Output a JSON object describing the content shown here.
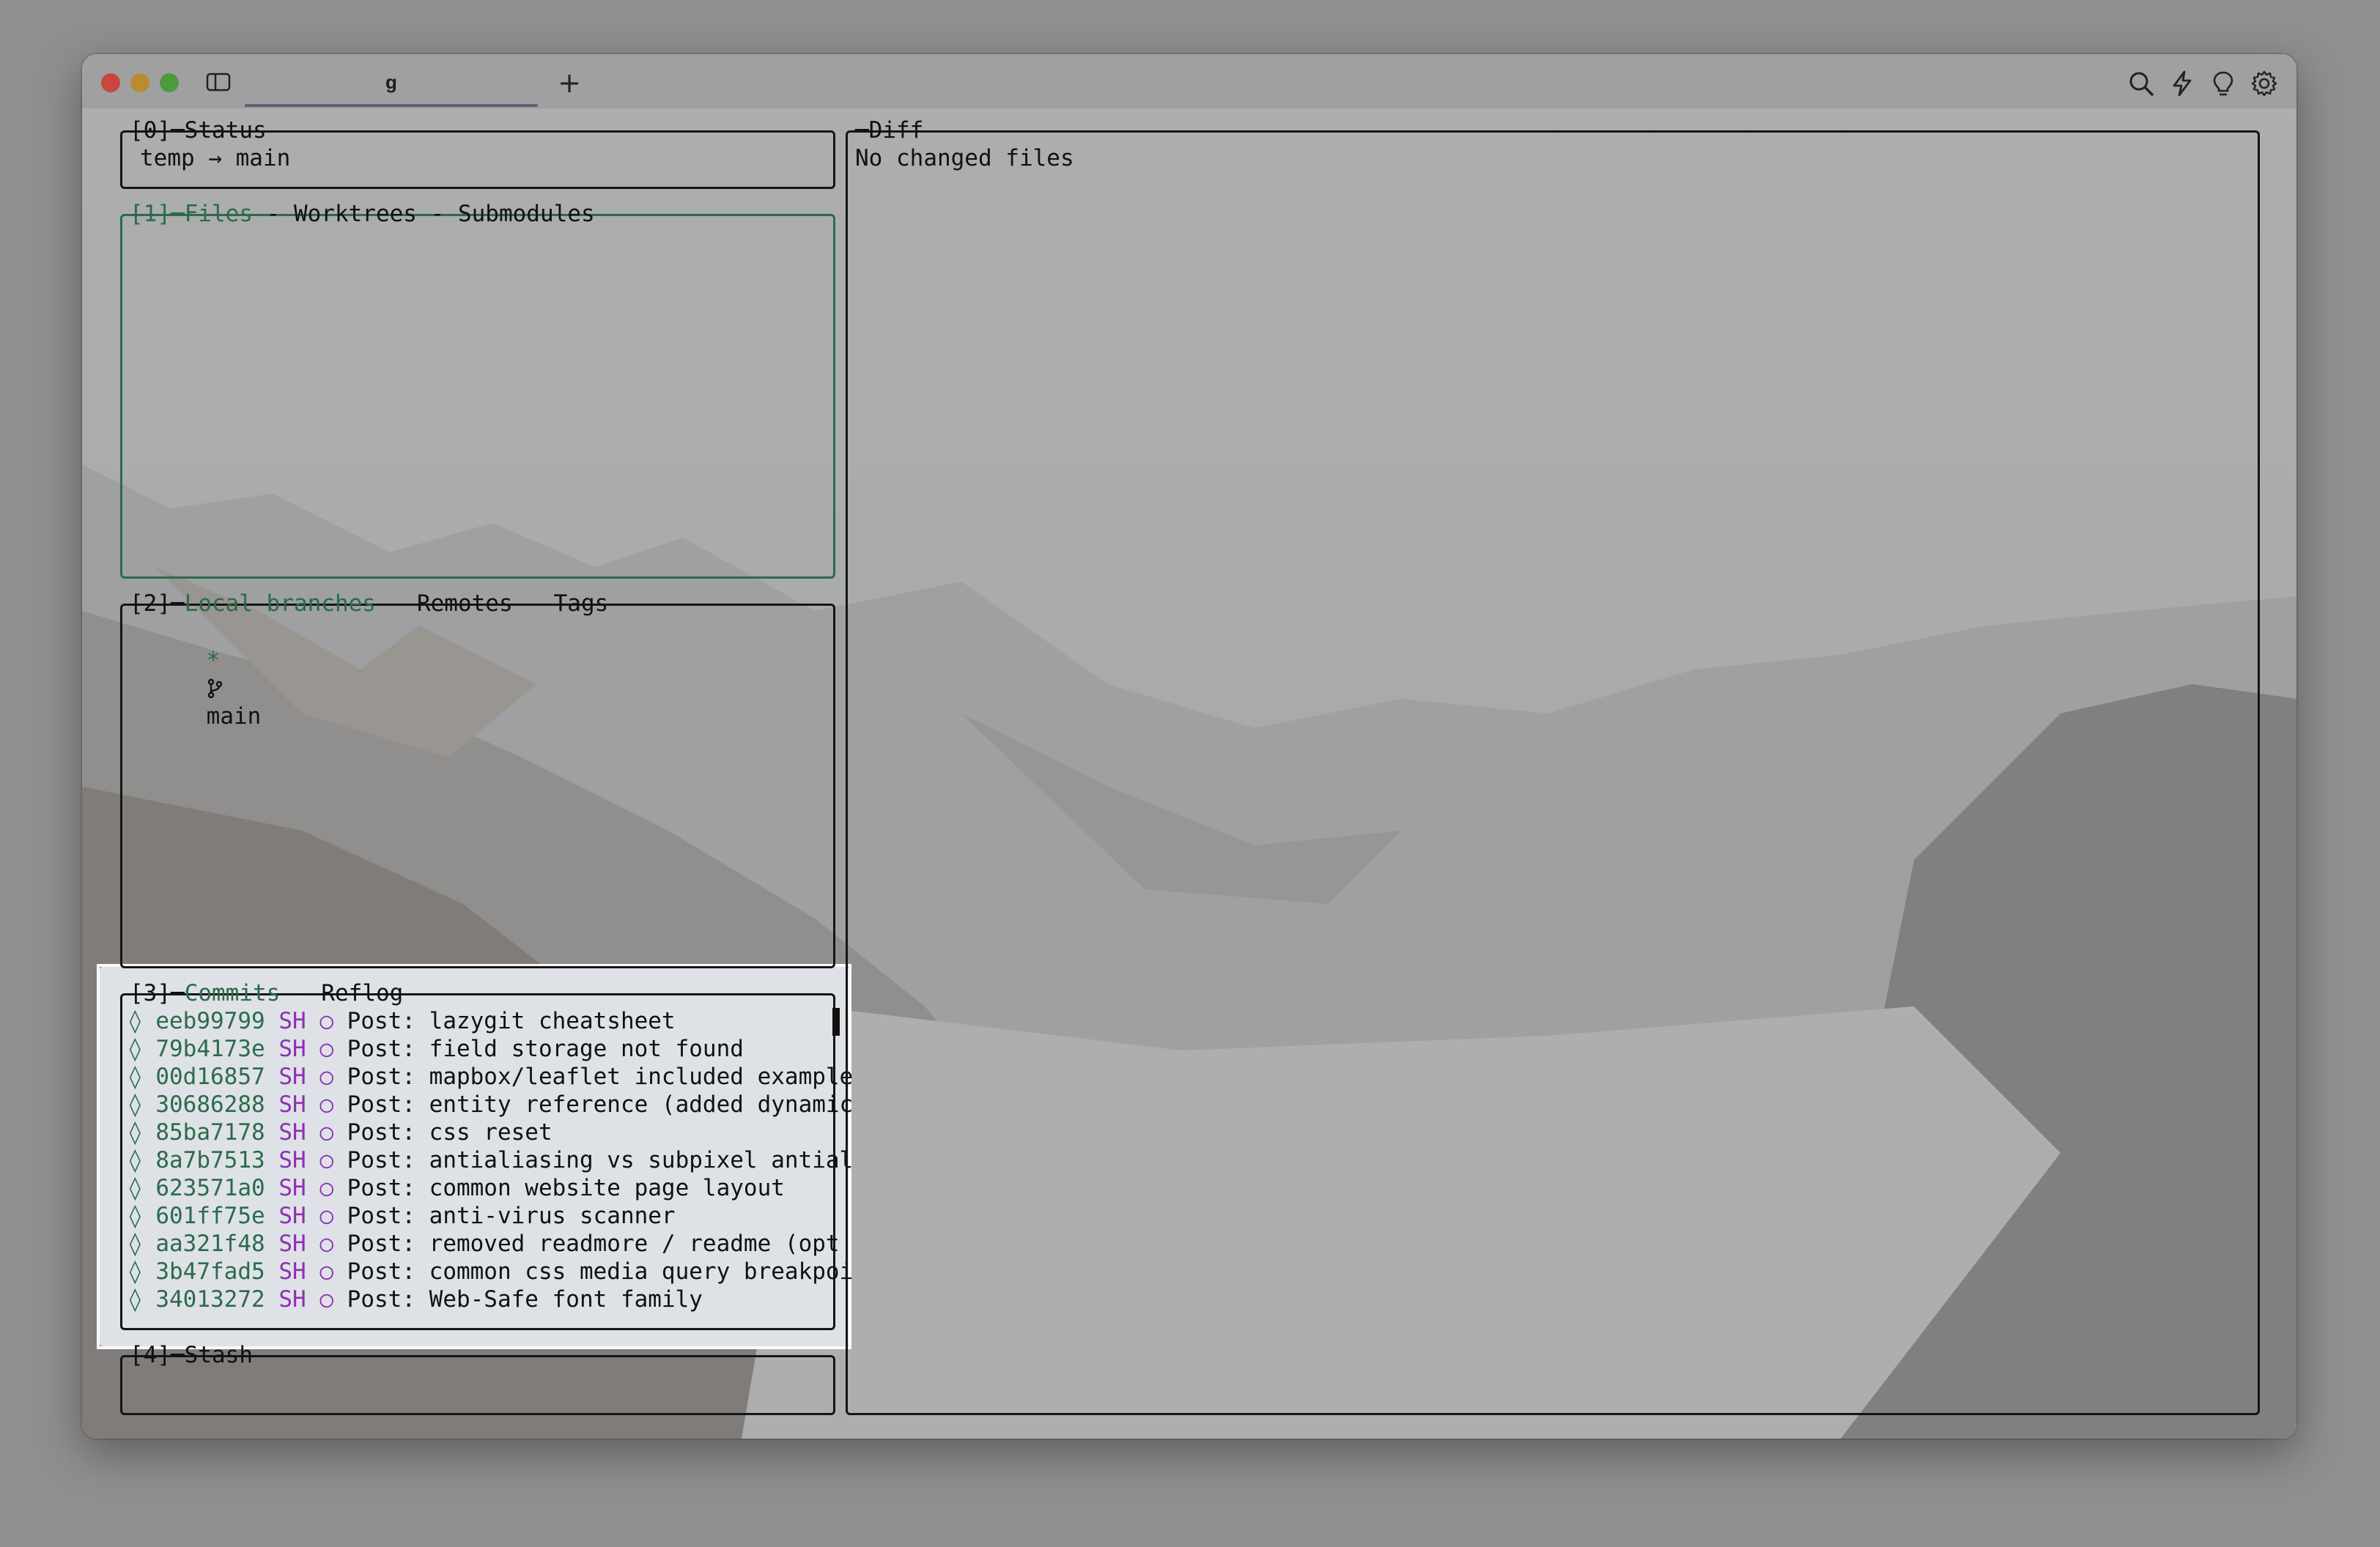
{
  "window": {
    "tab_title": "g",
    "new_tab_label": "+",
    "toolbar_icons": [
      "search-icon",
      "lightning-icon",
      "lightbulb-icon",
      "gear-icon"
    ],
    "traffic_lights": [
      "#c8473f",
      "#b98c32",
      "#4e9a3e"
    ]
  },
  "panels": {
    "status": {
      "title_index": "[0]",
      "title": "Status",
      "line": "temp → main"
    },
    "files": {
      "title_index": "[1]",
      "tabs": [
        "Files",
        "Worktrees",
        "Submodules"
      ],
      "sep": " - "
    },
    "branches": {
      "title_index": "[2]",
      "tabs": [
        "Local branches",
        "Remotes",
        "Tags"
      ],
      "sep": " - ",
      "items": [
        {
          "marker": "*",
          "icon": "git-branch-icon",
          "name": "main"
        }
      ]
    },
    "commits": {
      "title_index": "[3]",
      "tabs": [
        "Commits",
        "Reflog"
      ],
      "sep": " - ",
      "rows": [
        {
          "graph": "◊",
          "hash": "eeb99799",
          "author": "SH",
          "node": "○",
          "message": "Post: lazygit cheatsheet"
        },
        {
          "graph": "◊",
          "hash": "79b4173e",
          "author": "SH",
          "node": "○",
          "message": "Post: field storage not found"
        },
        {
          "graph": "◊",
          "hash": "00d16857",
          "author": "SH",
          "node": "○",
          "message": "Post: mapbox/leaflet included example"
        },
        {
          "graph": "◊",
          "hash": "30686288",
          "author": "SH",
          "node": "○",
          "message": "Post: entity reference (added dynamic"
        },
        {
          "graph": "◊",
          "hash": "85ba7178",
          "author": "SH",
          "node": "○",
          "message": "Post: css reset"
        },
        {
          "graph": "◊",
          "hash": "8a7b7513",
          "author": "SH",
          "node": "○",
          "message": "Post: antialiasing vs subpixel antial"
        },
        {
          "graph": "◊",
          "hash": "623571a0",
          "author": "SH",
          "node": "○",
          "message": "Post: common website page layout"
        },
        {
          "graph": "◊",
          "hash": "601ff75e",
          "author": "SH",
          "node": "○",
          "message": "Post: anti-virus scanner"
        },
        {
          "graph": "◊",
          "hash": "aa321f48",
          "author": "SH",
          "node": "○",
          "message": "Post: removed readmore / readme (opt"
        },
        {
          "graph": "◊",
          "hash": "3b47fad5",
          "author": "SH",
          "node": "○",
          "message": "Post: common css media query breakpoi"
        },
        {
          "graph": "◊",
          "hash": "34013272",
          "author": "SH",
          "node": "○",
          "message": "Post: Web-Safe font family"
        }
      ]
    },
    "stash": {
      "title_index": "[4]",
      "title": "Stash"
    },
    "diff": {
      "title": "Diff",
      "line": "No changed files"
    }
  },
  "colors": {
    "active_border": "#2c6a4c",
    "hash": "#2c6a4c",
    "author": "#8f2fb2"
  }
}
